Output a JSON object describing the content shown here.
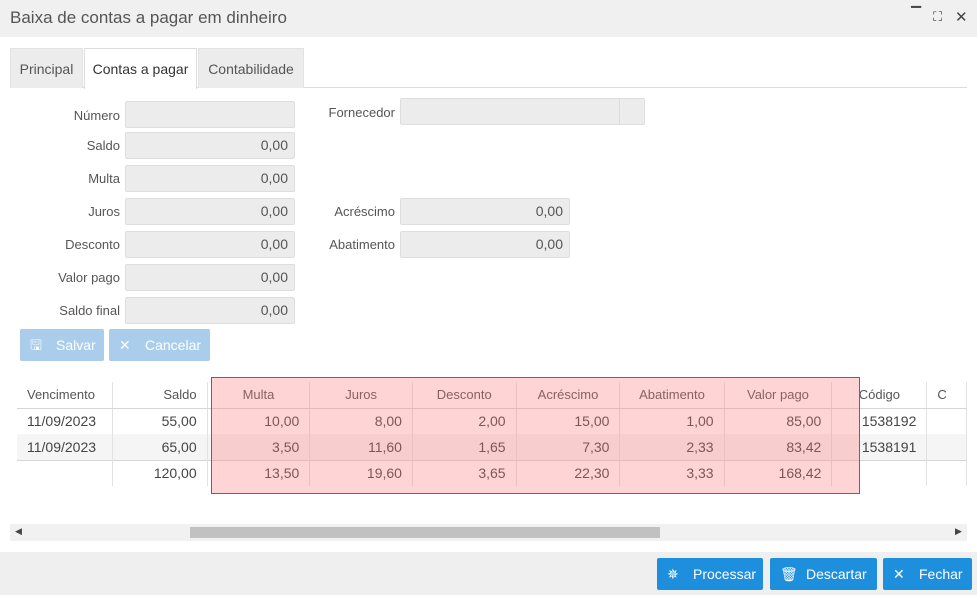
{
  "window": {
    "title": "Baixa de contas a pagar em dinheiro",
    "minimize_icon": "minimize-icon",
    "maximize_icon": "maximize-icon",
    "close_icon": "close-icon"
  },
  "tabs": [
    {
      "label": "Principal",
      "active": false
    },
    {
      "label": "Contas a pagar",
      "active": true
    },
    {
      "label": "Contabilidade",
      "active": false
    }
  ],
  "form": {
    "numero": {
      "label": "Número",
      "value": ""
    },
    "saldo": {
      "label": "Saldo",
      "value": "0,00"
    },
    "multa": {
      "label": "Multa",
      "value": "0,00"
    },
    "juros": {
      "label": "Juros",
      "value": "0,00"
    },
    "desconto": {
      "label": "Desconto",
      "value": "0,00"
    },
    "valor_pago": {
      "label": "Valor pago",
      "value": "0,00"
    },
    "saldo_final": {
      "label": "Saldo final",
      "value": "0,00"
    },
    "fornecedor": {
      "label": "Fornecedor",
      "value": ""
    },
    "acrescimo": {
      "label": "Acréscimo",
      "value": "0,00"
    },
    "abatimento": {
      "label": "Abatimento",
      "value": "0,00"
    }
  },
  "form_actions": {
    "save_label": "Salvar",
    "save_icon": "save-icon",
    "cancel_label": "Cancelar",
    "cancel_icon": "close-icon"
  },
  "grid": {
    "columns": [
      "Vencimento",
      "Saldo",
      "Multa",
      "Juros",
      "Desconto",
      "Acréscimo",
      "Abatimento",
      "Valor pago",
      "Código",
      "C"
    ],
    "rows": [
      [
        "11/09/2023",
        "55,00",
        "10,00",
        "8,00",
        "2,00",
        "15,00",
        "1,00",
        "85,00",
        "1538192",
        ""
      ],
      [
        "11/09/2023",
        "65,00",
        "3,50",
        "11,60",
        "1,65",
        "7,30",
        "2,33",
        "83,42",
        "1538191",
        ""
      ]
    ],
    "totals": [
      "",
      "120,00",
      "13,50",
      "19,60",
      "3,65",
      "22,30",
      "3,33",
      "168,42",
      "",
      ""
    ]
  },
  "footer": {
    "process_label": "Processar",
    "process_icon": "spinner-icon",
    "discard_label": "Descartar",
    "discard_icon": "trash-icon",
    "close_label": "Fechar",
    "close_icon": "close-icon"
  },
  "colors": {
    "primary": "#1e8fdc",
    "primary_disabled": "#a9cdeb",
    "highlight_border": "#d23a3a"
  }
}
